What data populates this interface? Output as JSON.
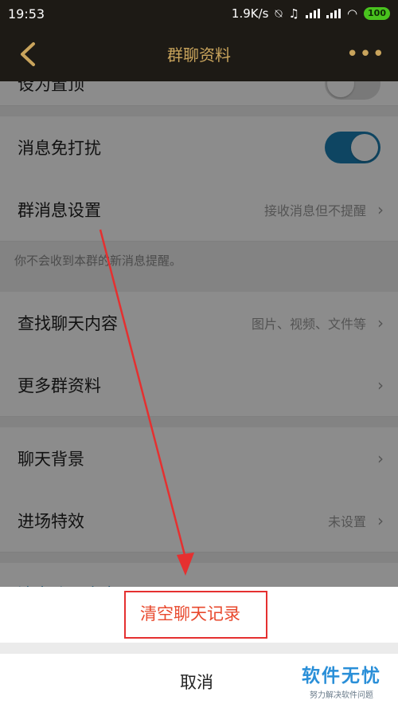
{
  "status": {
    "time": "19:53",
    "speed": "1.9K/s",
    "battery": "100"
  },
  "nav": {
    "title": "群聊资料"
  },
  "rows": {
    "pin": {
      "label": "设为置顶"
    },
    "mute": {
      "label": "消息免打扰"
    },
    "msg_settings": {
      "label": "群消息设置",
      "value": "接收消息但不提醒"
    },
    "note": "你不会收到本群的新消息提醒。",
    "search": {
      "label": "查找聊天内容",
      "value": "图片、视频、文件等"
    },
    "more_info": {
      "label": "更多群资料"
    },
    "background": {
      "label": "聊天背景"
    },
    "entry": {
      "label": "进场特效",
      "value": "未设置"
    },
    "partial": "清空聊天内容"
  },
  "sheet": {
    "clear": "清空聊天记录",
    "cancel": "取消"
  },
  "watermark": {
    "title": "软件无忧",
    "subtitle": "努力解决软件问题"
  },
  "colors": {
    "accent": "#c9a45c",
    "toggle_on": "#1b7fb3",
    "danger": "#e8492e",
    "highlight": "#e53030"
  }
}
